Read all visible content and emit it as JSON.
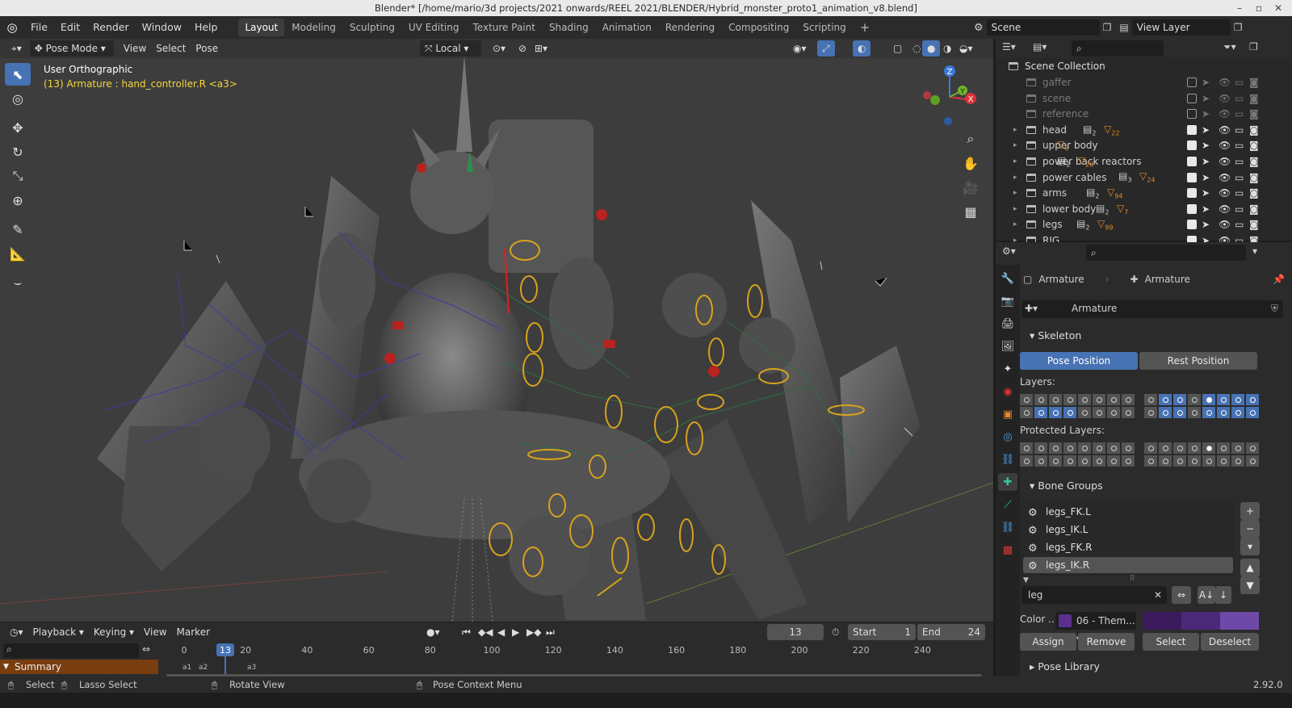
{
  "window": {
    "title": "Blender* [/home/mario/3d projects/2021 onwards/REEL 2021/BLENDER/Hybrid_monster_proto1_animation_v8.blend]"
  },
  "menus": [
    "File",
    "Edit",
    "Render",
    "Window",
    "Help"
  ],
  "workspaces": [
    {
      "label": "Layout",
      "active": true
    },
    {
      "label": "Modeling"
    },
    {
      "label": "Sculpting"
    },
    {
      "label": "UV Editing"
    },
    {
      "label": "Texture Paint"
    },
    {
      "label": "Shading"
    },
    {
      "label": "Animation"
    },
    {
      "label": "Rendering"
    },
    {
      "label": "Compositing"
    },
    {
      "label": "Scripting"
    }
  ],
  "scene": {
    "name": "Scene",
    "view_layer": "View Layer"
  },
  "viewport": {
    "mode": "Pose Mode",
    "menus": [
      "View",
      "Select",
      "Pose"
    ],
    "transform_orientation": "Local",
    "view_name": "User Orthographic",
    "active_info": "(13) Armature : hand_controller.R <a3>",
    "gizmo": {
      "x": "X",
      "y": "Y",
      "z": "Z"
    }
  },
  "outliner": {
    "root": "Scene Collection",
    "rows": [
      {
        "name": "gaffer",
        "dim": true,
        "checked": false
      },
      {
        "name": "scene",
        "dim": true,
        "checked": false
      },
      {
        "name": "reference",
        "dim": true,
        "checked": false
      },
      {
        "name": "head",
        "checked": true,
        "badges": [
          "2",
          "22"
        ]
      },
      {
        "name": "upper body",
        "checked": true,
        "badges": [
          "8"
        ]
      },
      {
        "name": "power back reactors",
        "checked": true,
        "badges": [
          "2",
          "20"
        ]
      },
      {
        "name": "power cables",
        "checked": true,
        "badges": [
          "3",
          "24"
        ]
      },
      {
        "name": "arms",
        "checked": true,
        "badges": [
          "2",
          "94"
        ]
      },
      {
        "name": "lower body",
        "checked": true,
        "badges": [
          "2",
          "7"
        ]
      },
      {
        "name": "legs",
        "checked": true,
        "badges": [
          "2",
          "99"
        ]
      },
      {
        "name": "RIG",
        "checked": true,
        "badges": []
      }
    ]
  },
  "properties": {
    "breadcrumb": [
      "Armature",
      "Armature"
    ],
    "datablock": "Armature",
    "skeleton": {
      "header": "Skeleton",
      "pose_btn": "Pose Position",
      "rest_btn": "Rest Position",
      "layers_label": "Layers:",
      "protected_label": "Protected Layers:"
    },
    "bone_groups": {
      "header": "Bone Groups",
      "items": [
        "legs_FK.L",
        "legs_IK.L",
        "legs_FK.R",
        "legs_IK.R"
      ],
      "selected": "legs_IK.R",
      "filter": "leg",
      "color_label": "Color ...",
      "color_value": "06 - Them...",
      "buttons": [
        "Assign",
        "Remove",
        "Select",
        "Deselect"
      ]
    },
    "pose_library": "Pose Library"
  },
  "timeline": {
    "menus": [
      "Playback",
      "Keying",
      "View",
      "Marker"
    ],
    "current_frame": "13",
    "start_label": "Start",
    "start": "1",
    "end_label": "End",
    "end": "24",
    "ticks": [
      "0",
      "20",
      "40",
      "60",
      "80",
      "100",
      "120",
      "140",
      "160",
      "180",
      "200",
      "220",
      "240"
    ],
    "summary": "Summary",
    "markers": [
      "a1",
      "a2",
      "a3"
    ]
  },
  "statusbar": {
    "select": "Select",
    "lasso": "Lasso Select",
    "rotate": "Rotate View",
    "context": "Pose Context Menu",
    "version": "2.92.0"
  }
}
